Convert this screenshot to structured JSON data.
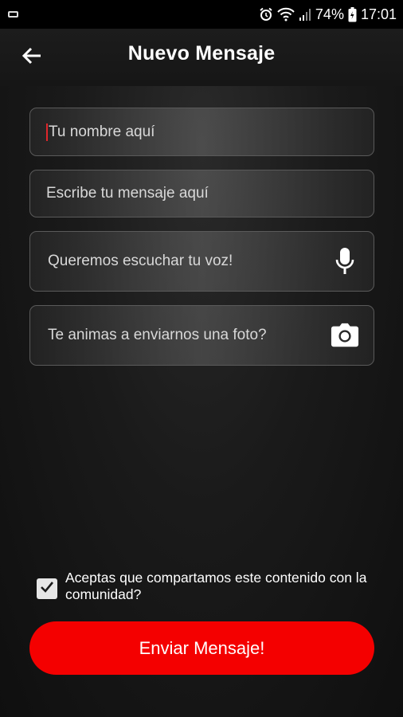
{
  "status_bar": {
    "battery_percent": "74%",
    "time": "17:01",
    "icons": [
      "notification-icon",
      "alarm-icon",
      "wifi-icon",
      "signal-icon",
      "battery-charging-icon"
    ]
  },
  "header": {
    "title": "Nuevo Mensaje",
    "back_icon": "arrow-left-icon"
  },
  "form": {
    "name_placeholder": "Tu nombre aquí",
    "message_placeholder": "Escribe tu mensaje aquí",
    "voice_label": "Queremos escuchar tu voz!",
    "voice_icon": "microphone-icon",
    "photo_label": "Te animas a enviarnos una foto?",
    "photo_icon": "camera-icon"
  },
  "consent": {
    "checked": true,
    "label": "Aceptas que compartamos este contenido con la comunidad?"
  },
  "submit": {
    "label": "Enviar Mensaje!"
  },
  "colors": {
    "accent": "#f40000",
    "background": "#141414",
    "caret": "#e0262b"
  }
}
